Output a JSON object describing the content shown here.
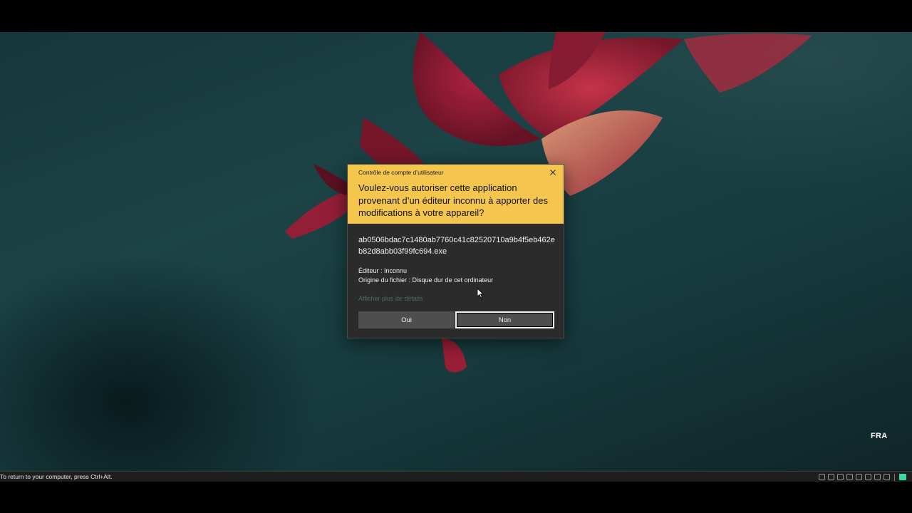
{
  "desktop": {
    "language_indicator": "FRA"
  },
  "uac_dialog": {
    "window_title": "Contrôle de compte d’utilisateur",
    "question": "Voulez-vous autoriser cette application provenant d’un éditeur inconnu à apporter des modifications à votre appareil?",
    "filename": "ab0506bdac7c1480ab7760c41c82520710a9b4f5eb462eb82d8abb03f99fc694.exe",
    "publisher": "Éditeur : Inconnu",
    "file_origin": "Origine du fichier : Disque dur de cet ordinateur",
    "show_more_link": "Afficher plus de détails",
    "yes_button": "Oui",
    "no_button": "Non",
    "header_color": "#f4c64e"
  },
  "vm_bar": {
    "hint": "To return to your computer, press Ctrl+Alt."
  }
}
